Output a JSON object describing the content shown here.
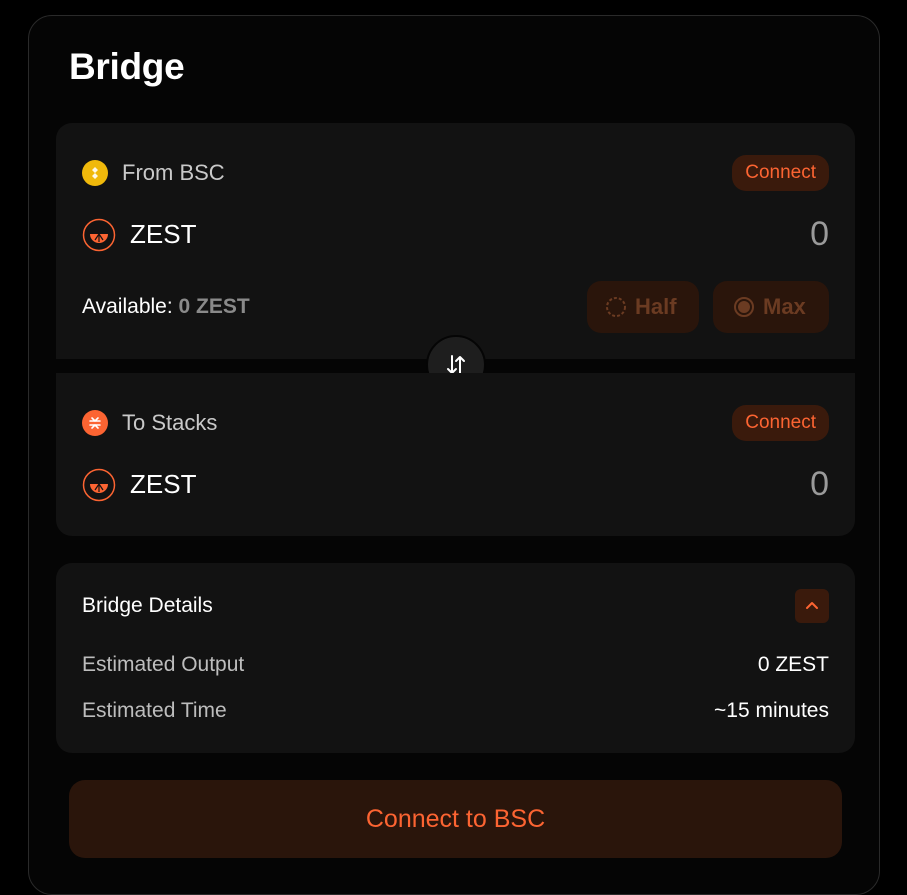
{
  "title": "Bridge",
  "from": {
    "chain_label": "From BSC",
    "chain_icon": "bsc-icon",
    "connect_label": "Connect",
    "token": "ZEST",
    "amount": "0",
    "available_label": "Available:",
    "available_value": "0 ZEST",
    "half_label": "Half",
    "max_label": "Max"
  },
  "to": {
    "chain_label": "To Stacks",
    "chain_icon": "stacks-icon",
    "connect_label": "Connect",
    "token": "ZEST",
    "amount": "0"
  },
  "details": {
    "title": "Bridge Details",
    "rows": [
      {
        "label": "Estimated Output",
        "value": "0 ZEST"
      },
      {
        "label": "Estimated Time",
        "value": "~15 minutes"
      }
    ]
  },
  "cta_label": "Connect to BSC",
  "colors": {
    "accent": "#fc6432",
    "accent_bg": "#3a1a0c",
    "bsc": "#f0b90b",
    "panel": "#121212"
  }
}
